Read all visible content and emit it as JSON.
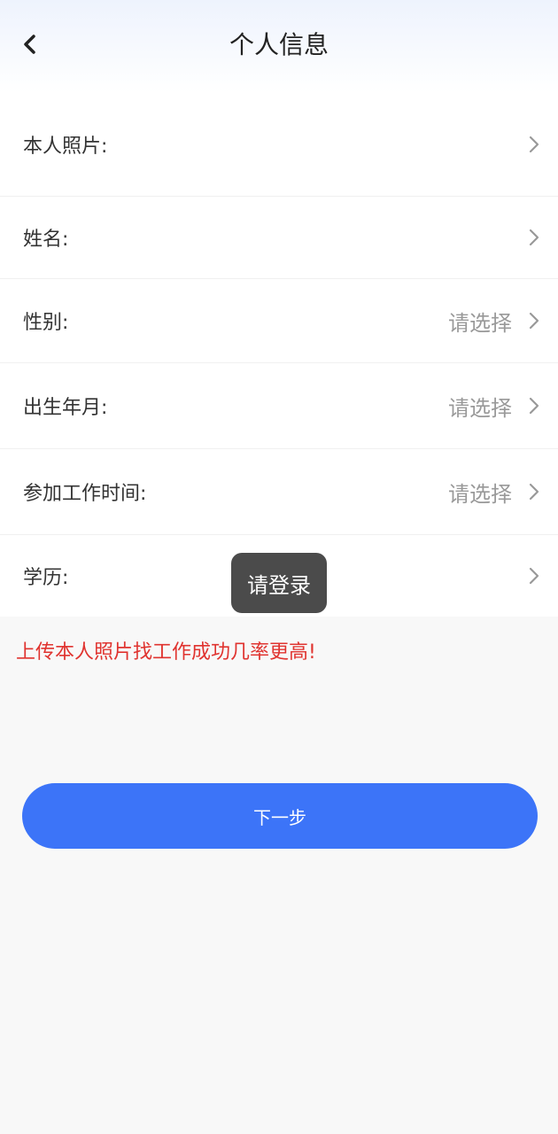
{
  "header": {
    "title": "个人信息",
    "back_icon": "chevron-left-icon"
  },
  "form": {
    "rows": [
      {
        "key": "photo",
        "label": "本人照片:",
        "value": ""
      },
      {
        "key": "name",
        "label": "姓名:",
        "value": ""
      },
      {
        "key": "gender",
        "label": "性别:",
        "value": "请选择"
      },
      {
        "key": "birth",
        "label": "出生年月:",
        "value": "请选择"
      },
      {
        "key": "worktime",
        "label": "参加工作时间:",
        "value": "请选择"
      },
      {
        "key": "education",
        "label": "学历:",
        "value": ""
      }
    ]
  },
  "hint": {
    "text": "上传本人照片找工作成功几率更高!",
    "color": "#e0332f"
  },
  "next_button": {
    "label": "下一步",
    "color": "#3c74f8"
  },
  "toast": {
    "text": "请登录"
  }
}
